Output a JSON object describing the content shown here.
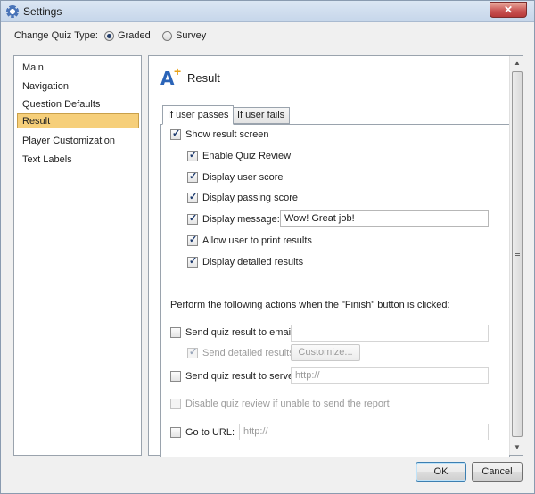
{
  "window": {
    "title": "Settings",
    "close_glyph": "✕"
  },
  "quiz_type": {
    "label": "Change Quiz Type:",
    "options": [
      {
        "label": "Graded",
        "selected": true
      },
      {
        "label": "Survey",
        "selected": false
      }
    ]
  },
  "nav": {
    "items": [
      {
        "label": "Main",
        "selected": false
      },
      {
        "label": "Navigation",
        "selected": false
      },
      {
        "label": "Question Defaults",
        "selected": false
      },
      {
        "label": "Result",
        "selected": true
      },
      {
        "label": "Player Customization",
        "selected": false
      },
      {
        "label": "Text Labels",
        "selected": false
      }
    ],
    "selected_color": "#f6cf7a"
  },
  "section": {
    "icon": "result-icon",
    "title": "Result"
  },
  "tabs": [
    {
      "label": "If user passes",
      "active": true
    },
    {
      "label": "If user fails",
      "active": false
    }
  ],
  "pass": {
    "show_result_screen": {
      "label": "Show result screen",
      "checked": true
    },
    "enable_quiz_review": {
      "label": "Enable Quiz Review",
      "checked": true
    },
    "display_user_score": {
      "label": "Display user score",
      "checked": true
    },
    "display_passing_score": {
      "label": "Display passing score",
      "checked": true
    },
    "display_message": {
      "label": "Display message:",
      "checked": true,
      "value": "Wow! Great job!"
    },
    "allow_print": {
      "label": "Allow user to print results",
      "checked": true
    },
    "display_detailed": {
      "label": "Display detailed results",
      "checked": true
    },
    "actions_heading": "Perform the following actions when the \"Finish\" button is clicked:",
    "send_email": {
      "label": "Send quiz result to email:",
      "checked": false,
      "value": ""
    },
    "send_detailed": {
      "label": "Send detailed results",
      "checked": true,
      "button": "Customize..."
    },
    "send_server": {
      "label": "Send quiz result to server:",
      "checked": false,
      "value": "http://"
    },
    "disable_review": {
      "label": "Disable quiz review if unable to send the report",
      "checked": false
    },
    "goto_url": {
      "label": "Go to URL:",
      "checked": false,
      "value": "http://"
    }
  },
  "footer": {
    "ok": "OK",
    "cancel": "Cancel"
  }
}
